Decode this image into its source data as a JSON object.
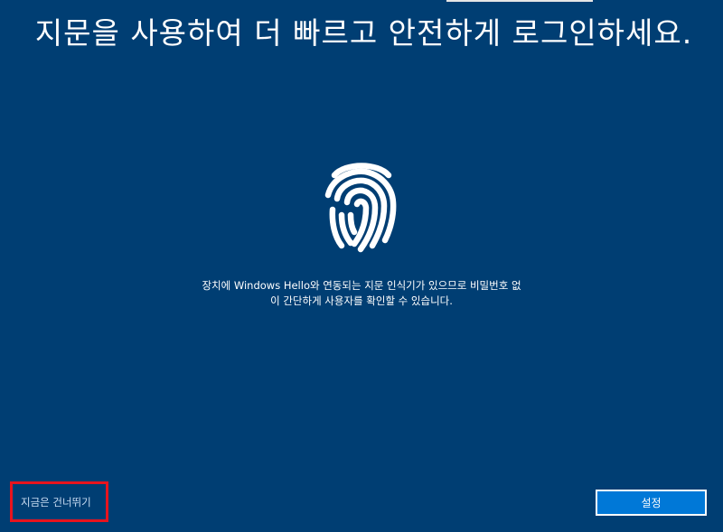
{
  "title": "지문을 사용하여 더 빠르고 안전하게 로그인하세요.",
  "icon": "fingerprint-icon",
  "description": {
    "line1": "장치에 Windows Hello와 연동되는 지문 인식기가 있으므로 비밀번호 없",
    "line2": "이 간단하게 사용자를 확인할 수 있습니다."
  },
  "skip_label": "지금은 건너뛰기",
  "setup_label": "설정",
  "colors": {
    "background": "#003e73",
    "button": "#0078d7",
    "highlight_border": "#e8141e",
    "text": "#ffffff"
  }
}
